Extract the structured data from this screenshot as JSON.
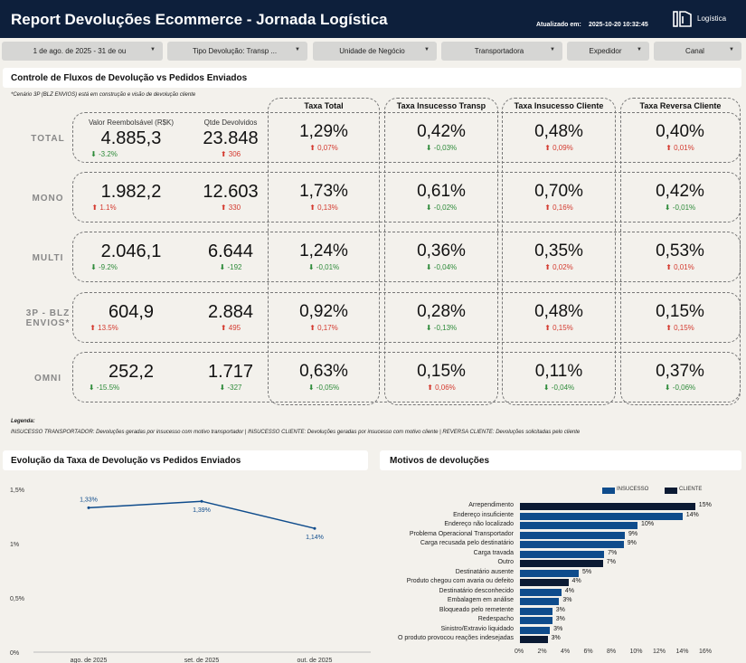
{
  "header": {
    "title": "Report Devoluções Ecommerce - Jornada Logística",
    "updated_label": "Atualizado em:",
    "updated_value": "2025-10-20 10:32:45",
    "logo_text": "Logística"
  },
  "filters": [
    {
      "label": "1 de ago. de 2025 - 31 de ou"
    },
    {
      "label": "Tipo Devolução: Transp ..."
    },
    {
      "label": "Unidade de Negócio"
    },
    {
      "label": "Transportadora"
    },
    {
      "label": "Expedidor"
    },
    {
      "label": "Canal"
    }
  ],
  "control": {
    "title": "Controle de Fluxos de Devolução vs Pedidos Enviados",
    "note": "*Cenário 3P (BLZ ENVIOS) está em construção e visão de devolução cliente",
    "sub_valor": "Valor Reembolsável (R$K)",
    "sub_qtde": "Qtde Devolvidos",
    "columns": [
      "Taxa Total",
      "Taxa Insucesso Transp",
      "Taxa Insucesso Cliente",
      "Taxa Reversa Cliente"
    ],
    "rows": [
      {
        "label": "TOTAL",
        "valor": "4.885,3",
        "valor_var": "⬇ -3.2%",
        "valor_dir": "dn",
        "qtde": "23.848",
        "qtde_var": "⬆ 306",
        "qtde_dir": "up",
        "rates": [
          {
            "v": "1,29%",
            "d": "⬆ 0,07%",
            "dir": "up"
          },
          {
            "v": "0,42%",
            "d": "⬇ -0,03%",
            "dir": "dn"
          },
          {
            "v": "0,48%",
            "d": "⬆ 0,09%",
            "dir": "up"
          },
          {
            "v": "0,40%",
            "d": "⬆ 0,01%",
            "dir": "up"
          }
        ]
      },
      {
        "label": "MONO",
        "valor": "1.982,2",
        "valor_var": "⬆ 1.1%",
        "valor_dir": "up",
        "qtde": "12.603",
        "qtde_var": "⬆ 330",
        "qtde_dir": "up",
        "rates": [
          {
            "v": "1,73%",
            "d": "⬆ 0,13%",
            "dir": "up"
          },
          {
            "v": "0,61%",
            "d": "⬇ -0,02%",
            "dir": "dn"
          },
          {
            "v": "0,70%",
            "d": "⬆ 0,16%",
            "dir": "up"
          },
          {
            "v": "0,42%",
            "d": "⬇ -0,01%",
            "dir": "dn"
          }
        ]
      },
      {
        "label": "MULTI",
        "valor": "2.046,1",
        "valor_var": "⬇ -9.2%",
        "valor_dir": "dn",
        "qtde": "6.644",
        "qtde_var": "⬇ -192",
        "qtde_dir": "dn",
        "rates": [
          {
            "v": "1,24%",
            "d": "⬇ -0,01%",
            "dir": "dn"
          },
          {
            "v": "0,36%",
            "d": "⬇ -0,04%",
            "dir": "dn"
          },
          {
            "v": "0,35%",
            "d": "⬆ 0,02%",
            "dir": "up"
          },
          {
            "v": "0,53%",
            "d": "⬆ 0,01%",
            "dir": "up"
          }
        ]
      },
      {
        "label": "3P - BLZ ENVIOS*",
        "valor": "604,9",
        "valor_var": "⬆ 13.5%",
        "valor_dir": "up",
        "qtde": "2.884",
        "qtde_var": "⬆ 495",
        "qtde_dir": "up",
        "rates": [
          {
            "v": "0,92%",
            "d": "⬆ 0,17%",
            "dir": "up"
          },
          {
            "v": "0,28%",
            "d": "⬇ -0,13%",
            "dir": "dn"
          },
          {
            "v": "0,48%",
            "d": "⬆ 0,15%",
            "dir": "up"
          },
          {
            "v": "0,15%",
            "d": "⬆ 0,15%",
            "dir": "up"
          }
        ]
      },
      {
        "label": "OMNI",
        "valor": "252,2",
        "valor_var": "⬇ -15.5%",
        "valor_dir": "dn",
        "qtde": "1.717",
        "qtde_var": "⬇ -327",
        "qtde_dir": "dn",
        "rates": [
          {
            "v": "0,63%",
            "d": "⬇ -0,05%",
            "dir": "dn"
          },
          {
            "v": "0,15%",
            "d": "⬆ 0,06%",
            "dir": "up"
          },
          {
            "v": "0,11%",
            "d": "⬇ -0,04%",
            "dir": "dn"
          },
          {
            "v": "0,37%",
            "d": "⬇ -0,06%",
            "dir": "dn"
          }
        ]
      }
    ],
    "legend_title": "Legenda:",
    "legend_text": "INSUCESSO TRANSPORTADOR: Devoluções geradas por insucesso com motivo transportador | INSUCESSO CLIENTE: Devoluções geradas por insucesso com motivo cliente | REVERSA CLIENTE: Devoluções solicitadas pelo cliente"
  },
  "colors": {
    "header": "#0d1f3b",
    "insucesso": "#0f4c8c",
    "cliente": "#0b1a33",
    "up": "#d43a2f",
    "down": "#2e8b3a"
  },
  "chart_data": [
    {
      "type": "line",
      "title": "Evolução da Taxa de Devolução vs Pedidos Enviados",
      "categories": [
        "ago. de 2025",
        "set. de 2025",
        "out. de 2025"
      ],
      "values": [
        1.33,
        1.39,
        1.14
      ],
      "data_labels": [
        "1,33%",
        "1,39%",
        "1,14%"
      ],
      "ylim": [
        0,
        1.5
      ],
      "yticks": [
        "0%",
        "0,5%",
        "1%",
        "1,5%"
      ]
    },
    {
      "type": "bar",
      "orientation": "horizontal",
      "title": "Motivos de devoluções",
      "legend": [
        {
          "name": "INSUCESSO",
          "color": "#0f4c8c"
        },
        {
          "name": "CLIENTE",
          "color": "#0b1a33"
        }
      ],
      "categories": [
        "Arrependimento",
        "Endereço insuficiente",
        "Endereço não localizado",
        "Problema Operacional Transportador",
        "Carga recusada pelo destinatário",
        "Carga travada",
        "Outro",
        "Destinatário ausente",
        "Produto chegou com avaria ou defeito",
        "Destinatário desconhecido",
        "Embalagem em análise",
        "Bloqueado pelo remetente",
        "Redespacho",
        "Sinistro/Extravio liquidado",
        "O produto provocou reações indesejadas"
      ],
      "values": [
        15.2,
        14.1,
        10.2,
        9.1,
        9.0,
        7.3,
        7.2,
        5.1,
        4.2,
        3.6,
        3.4,
        2.8,
        2.8,
        2.6,
        2.4
      ],
      "data_labels": [
        "15%",
        "14%",
        "10%",
        "9%",
        "9%",
        "7%",
        "7%",
        "5%",
        "4%",
        "4%",
        "3%",
        "3%",
        "3%",
        "3%",
        "3%"
      ],
      "group": [
        "CLIENTE",
        "INSUCESSO",
        "INSUCESSO",
        "INSUCESSO",
        "INSUCESSO",
        "INSUCESSO",
        "CLIENTE",
        "INSUCESSO",
        "CLIENTE",
        "INSUCESSO",
        "INSUCESSO",
        "INSUCESSO",
        "INSUCESSO",
        "INSUCESSO",
        "CLIENTE"
      ],
      "xlim": [
        0,
        16
      ],
      "xticks": [
        "0%",
        "2%",
        "4%",
        "6%",
        "8%",
        "10%",
        "12%",
        "14%",
        "16%"
      ]
    }
  ]
}
